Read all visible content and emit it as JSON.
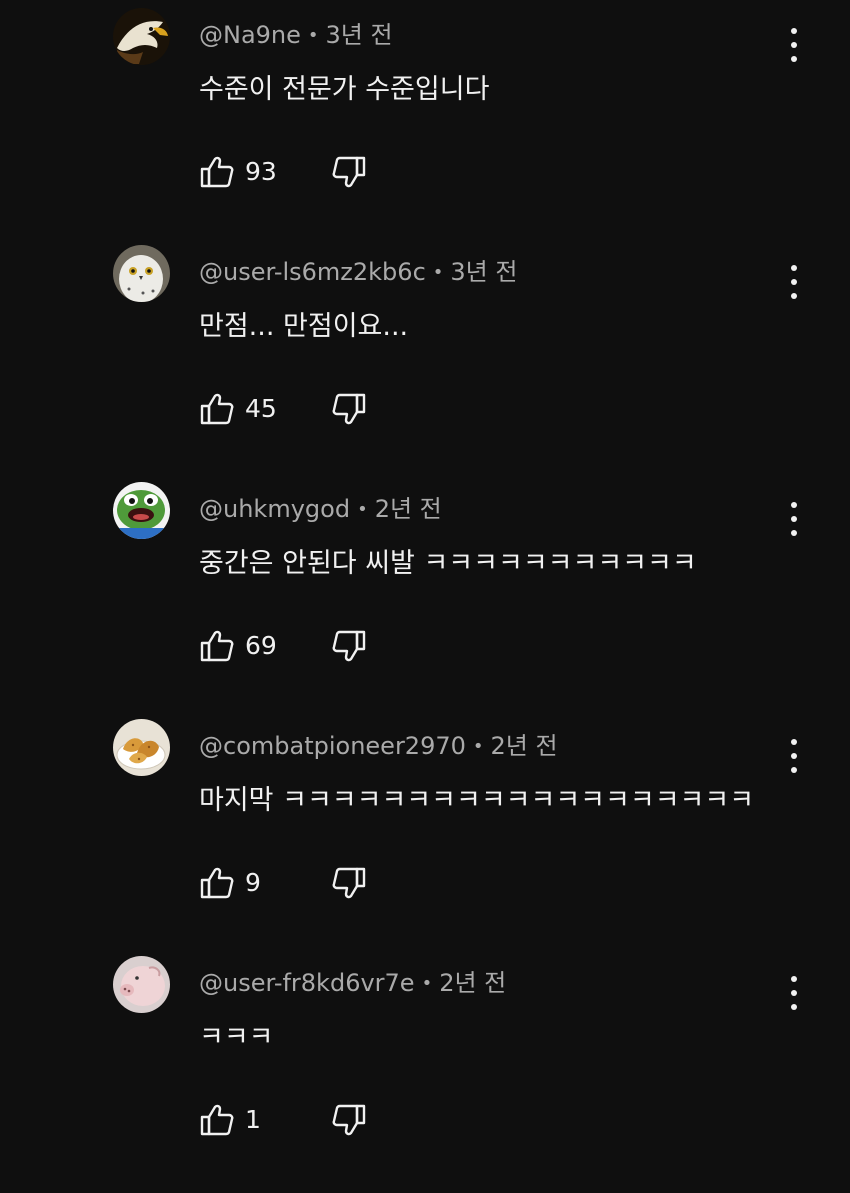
{
  "comments": [
    {
      "author": "@Na9ne",
      "separator": "•",
      "time": "3년 전",
      "text": "수준이 전문가 수준입니다",
      "likes": "93",
      "avatar_icon": "eagle-avatar-icon"
    },
    {
      "author": "@user-ls6mz2kb6c",
      "separator": "•",
      "time": "3년 전",
      "text": "만점... 만점이요...",
      "likes": "45",
      "avatar_icon": "owl-avatar-icon"
    },
    {
      "author": "@uhkmygod",
      "separator": "•",
      "time": "2년 전",
      "text": "중간은 안된다 씨발 ㅋㅋㅋㅋㅋㅋㅋㅋㅋㅋㅋ",
      "likes": "69",
      "avatar_icon": "frog-avatar-icon"
    },
    {
      "author": "@combatpioneer2970",
      "separator": "•",
      "time": "2년 전",
      "text": "마지막 ㅋㅋㅋㅋㅋㅋㅋㅋㅋㅋㅋㅋㅋㅋㅋㅋㅋㅋㅋ",
      "likes": "9",
      "avatar_icon": "fried-food-avatar-icon"
    },
    {
      "author": "@user-fr8kd6vr7e",
      "separator": "•",
      "time": "2년 전",
      "text": "ㅋㅋㅋ",
      "likes": "1",
      "avatar_icon": "pink-animal-avatar-icon"
    }
  ],
  "icons": {
    "like": "thumbs-up-icon",
    "dislike": "thumbs-down-icon",
    "more": "more-vert-icon"
  },
  "colors": {
    "background": "#0f0f0f",
    "primary_text": "#f1f1f1",
    "secondary_text": "#aaaaaa"
  }
}
